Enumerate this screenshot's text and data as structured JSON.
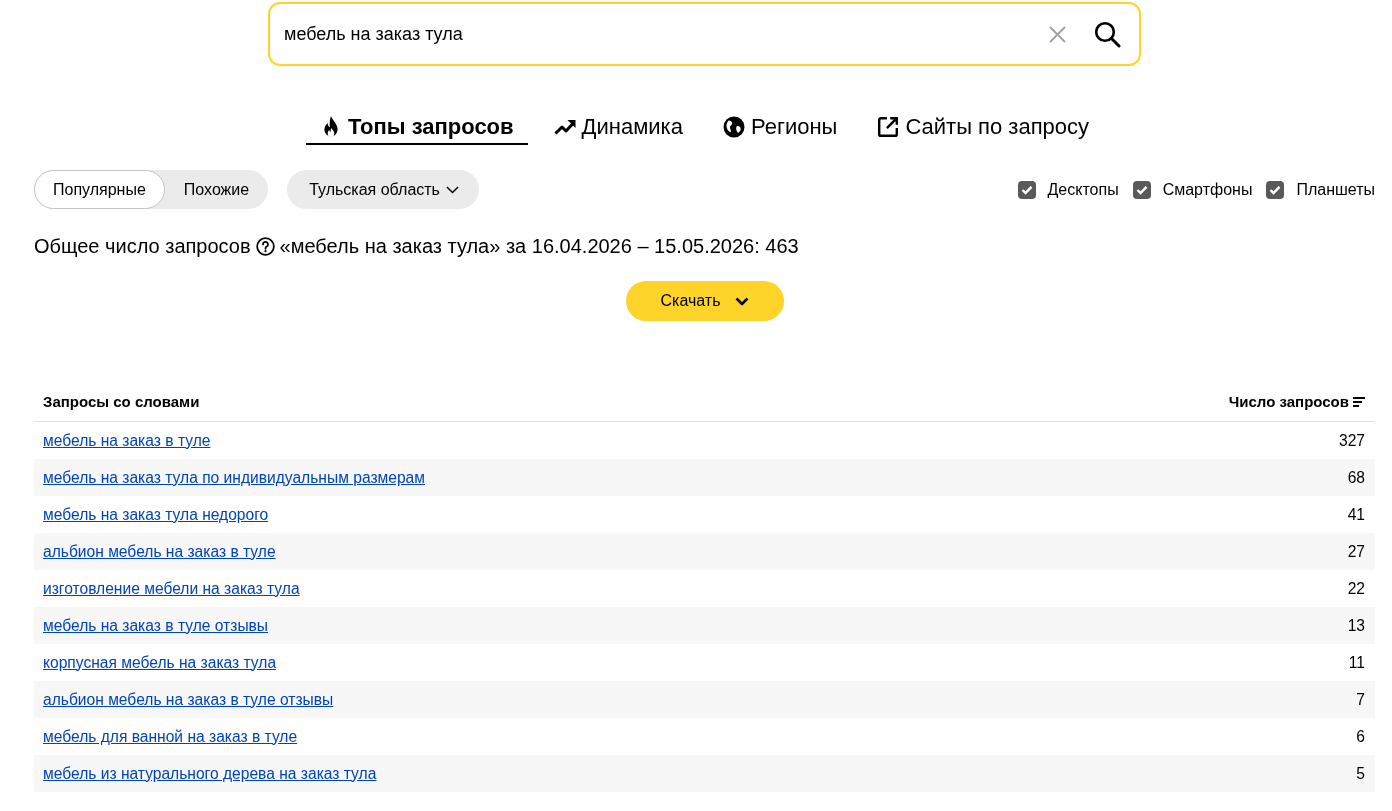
{
  "search": {
    "value": "мебель на заказ тула"
  },
  "tabs": [
    {
      "label": "Топы запросов",
      "selected": true
    },
    {
      "label": "Динамика",
      "selected": false
    },
    {
      "label": "Регионы",
      "selected": false
    },
    {
      "label": "Сайты по запросу",
      "selected": false
    }
  ],
  "mode_toggle": [
    {
      "label": "Популярные",
      "selected": true
    },
    {
      "label": "Похожие",
      "selected": false
    }
  ],
  "region_dropdown": {
    "label": "Тульская область"
  },
  "devices": [
    {
      "label": "Десктопы",
      "checked": true
    },
    {
      "label": "Смартфоны",
      "checked": true
    },
    {
      "label": "Планшеты",
      "checked": true
    }
  ],
  "summary": {
    "label": "Общее число запросов",
    "text": "«мебель на заказ тула» за 16.04.2026 – 15.05.2026: 463"
  },
  "download_button": {
    "label": "Скачать"
  },
  "table": {
    "columns": [
      {
        "label": "Запросы со словами"
      },
      {
        "label": "Число запросов",
        "sorted": true
      }
    ],
    "rows": [
      {
        "query": "мебель на заказ в туле",
        "count": "327"
      },
      {
        "query": "мебель на заказ тула по индивидуальным размерам",
        "count": "68"
      },
      {
        "query": "мебель на заказ тула недорого",
        "count": "41"
      },
      {
        "query": "альбион мебель на заказ в туле",
        "count": "27"
      },
      {
        "query": "изготовление мебели на заказ тула",
        "count": "22"
      },
      {
        "query": "мебель на заказ в туле отзывы",
        "count": "13"
      },
      {
        "query": "корпусная мебель на заказ тула",
        "count": "11"
      },
      {
        "query": "альбион мебель на заказ в туле отзывы",
        "count": "7"
      },
      {
        "query": "мебель для ванной на заказ в туле",
        "count": "6"
      },
      {
        "query": "мебель из натурального дерева на заказ тула",
        "count": "5"
      }
    ]
  }
}
